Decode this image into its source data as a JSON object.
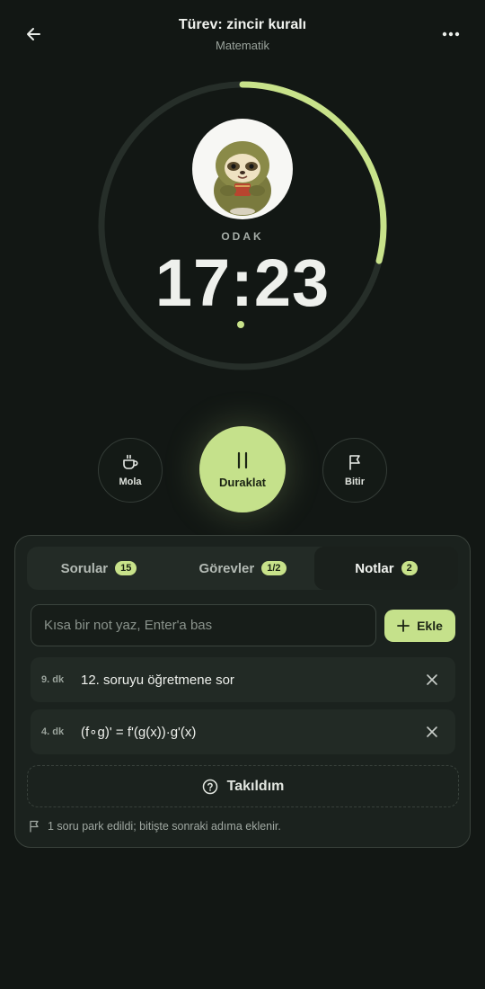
{
  "header": {
    "title": "Türev: zincir kuralı",
    "subtitle": "Matematik",
    "back_icon": "arrow-left-icon",
    "more_icon": "more-horizontal-icon"
  },
  "timer": {
    "mode_label": "ODAK",
    "time": "17:23",
    "progress_fraction": 0.29,
    "accent_color": "#c8e28a",
    "avatar": "sloth-mascot-image"
  },
  "controls": {
    "break_label": "Mola",
    "break_icon": "coffee-cup-icon",
    "pause_label": "Duraklat",
    "pause_icon": "pause-icon",
    "finish_label": "Bitir",
    "finish_icon": "flag-icon"
  },
  "tabs": [
    {
      "label": "Sorular",
      "count": "15",
      "active": false
    },
    {
      "label": "Görevler",
      "count": "1/2",
      "active": false
    },
    {
      "label": "Notlar",
      "count": "2",
      "active": true
    }
  ],
  "note_input": {
    "placeholder": "Kısa bir not yaz, Enter'a bas",
    "value": "",
    "add_label": "Ekle"
  },
  "notes": [
    {
      "minute": "9. dk",
      "text": "12. soruyu öğretmene sor"
    },
    {
      "minute": "4. dk",
      "text": "(f∘g)' = f'(g(x))·g'(x)"
    }
  ],
  "stuck_button": {
    "label": "Takıldım",
    "icon": "question-circle-icon"
  },
  "footnote": {
    "text": "1 soru park edildi; bitişte sonraki adıma eklenir.",
    "icon": "flag-icon"
  }
}
